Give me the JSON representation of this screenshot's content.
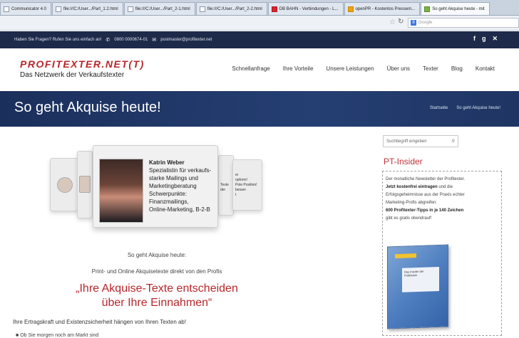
{
  "browser": {
    "tabs": [
      {
        "label": "Communicator 4.0",
        "favicon": "plain"
      },
      {
        "label": "file:///C:/User.../Part_1.2.html",
        "favicon": "plain"
      },
      {
        "label": "file:///C:/User.../Part_2-1.html",
        "favicon": "plain"
      },
      {
        "label": "file:///C:/User.../Part_2-2.html",
        "favicon": "plain"
      },
      {
        "label": "DB BAHN - Verbindungen - L...",
        "favicon": "db"
      },
      {
        "label": "openPR - Kostenlos Pressem...",
        "favicon": "pr"
      },
      {
        "label": "So geht Akquise heute - mit",
        "favicon": "gr"
      }
    ],
    "search_placeholder": "Google",
    "search_badge": "8"
  },
  "infobar": {
    "question": "Haben Sie Fragen? Rufen Sie uns einfach an!",
    "phone": "0800 0000674-01",
    "email": "postmaster@profitexter.net",
    "social": [
      "f",
      "g",
      "t"
    ]
  },
  "header": {
    "logo_main": "PROFITEXTER.NET(T)",
    "logo_sub": "Das Netzwerk der Verkaufstexter",
    "nav": [
      "Schnellanfrage",
      "Ihre Vorteile",
      "Unsere Leistungen",
      "Über uns",
      "Texter",
      "Blog",
      "Kontakt"
    ]
  },
  "title_band": {
    "title": "So geht Akquise heute!",
    "breadcrumb": [
      "Startseite",
      "So geht Akquise heute!"
    ]
  },
  "carousel": {
    "name": "Katrin Weber",
    "lines": [
      "Spezialistin für verkaufs-",
      "starke Mailings und",
      "Marketingberatung",
      "Schwerpunkte:",
      "Finanzmailings,",
      "Online-Marketing, B-2-B"
    ],
    "right_snippets": [
      "Texte",
      "der"
    ],
    "far_right_snippets": [
      "ei",
      "",
      "opform!",
      "Pole Position!",
      "besser",
      "t"
    ]
  },
  "content": {
    "intro": "So geht Akquise heute:",
    "sub": "Print- und Online Akquisetexte direkt von den Profis",
    "headline_1": "„Ihre Akquise-Texte entscheiden",
    "headline_2": "über Ihre Einnahmen“",
    "tagline": "Ihre Ertragskraft und Existenzsicherheit hängen von Ihren Texten ab!",
    "bullet": "Ob Sie morgen noch am Markt sind"
  },
  "sidebar": {
    "search_placeholder": "Suchbegriff eingeben",
    "title": "PT-Insider",
    "text_1": "Der monatliche Newsletter der Profitexter.",
    "text_bold_1": "Jetzt kostenfrei eintragen",
    "text_2": " und die",
    "text_3": "Erfolgsgeheimnisse aus der Praxis echter",
    "text_4": "Marketing-Profis abgreifen:",
    "text_bold_2": "600 Profitexter-Tipps in je 140 Zeichen",
    "text_5": "gibt es gratis obendrauf!",
    "book_label": "Das Insider der Profitexter"
  },
  "colors": {
    "brand_red": "#b8262b",
    "dark_navy": "#1e2a4a",
    "title_blue": "#1f3a6e"
  }
}
